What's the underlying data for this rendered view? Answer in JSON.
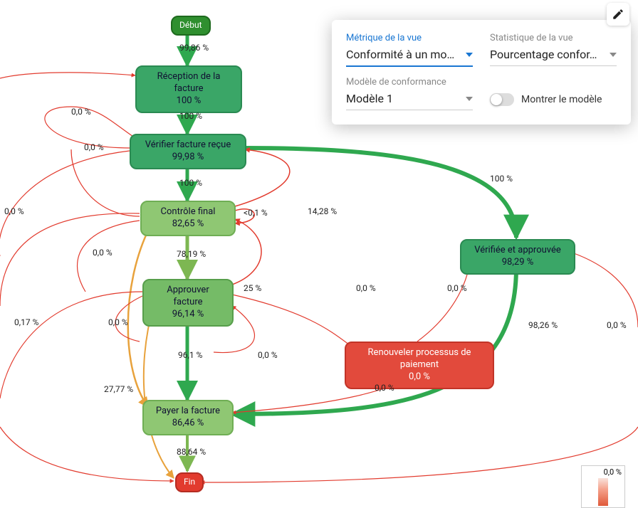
{
  "panel": {
    "metric_label": "Métrique de la vue",
    "metric_value": "Conformité à un mo…",
    "stat_label": "Statistique de la vue",
    "stat_value": "Pourcentage confor…",
    "model_label": "Modèle de conformance",
    "model_value": "Modèle 1",
    "toggle_label": "Montrer le modèle"
  },
  "legend": {
    "top_label": "0,0 %"
  },
  "nodes": {
    "start": {
      "label": "Début"
    },
    "recv": {
      "label": "Réception de la facture",
      "pct": "100 %"
    },
    "verify": {
      "label": "Vérifier facture reçue",
      "pct": "99,98 %"
    },
    "control": {
      "label": "Contrôle final",
      "pct": "82,65 %"
    },
    "approve": {
      "label": "Approuver facture",
      "pct": "96,14 %"
    },
    "pay": {
      "label": "Payer la facture",
      "pct": "86,46 %"
    },
    "end": {
      "label": "Fin"
    },
    "verified": {
      "label": "Vérifiée et approuvée",
      "pct": "98,29 %"
    },
    "renew": {
      "label": "Renouveler processus de paiement",
      "pct": "0,0 %"
    }
  },
  "edges": {
    "e_start_recv": "99,86 %",
    "e_recv_verify": "100 %",
    "e_verify_control": "100 %",
    "e_control_approve": "78,19 %",
    "e_approve_pay": "96,1 %",
    "e_pay_end": "88,64 %",
    "e_verify_verified": "100 %",
    "e_verified_pay": "98,26 %",
    "e_control_self": "<0,1 %",
    "e_control_verify": "14,28 %",
    "e_approve_control": "25 %",
    "e_control_pay": "27,77 %",
    "e_left00a": "0,0 %",
    "e_left00b": "0,0 %",
    "e_left00c": "0,0 %",
    "e_left00d": "0,0 %",
    "e_leftpct": "0,17 %",
    "e_left00e": "0,0 %",
    "e_mid00a": "0,0 %",
    "e_mid00b": "0,0 %",
    "e_mid00c": "0,0 %",
    "e_mid00d": "0,0 %",
    "e_right00a": "0,0 %",
    "e_right00b": "0,0 %"
  }
}
